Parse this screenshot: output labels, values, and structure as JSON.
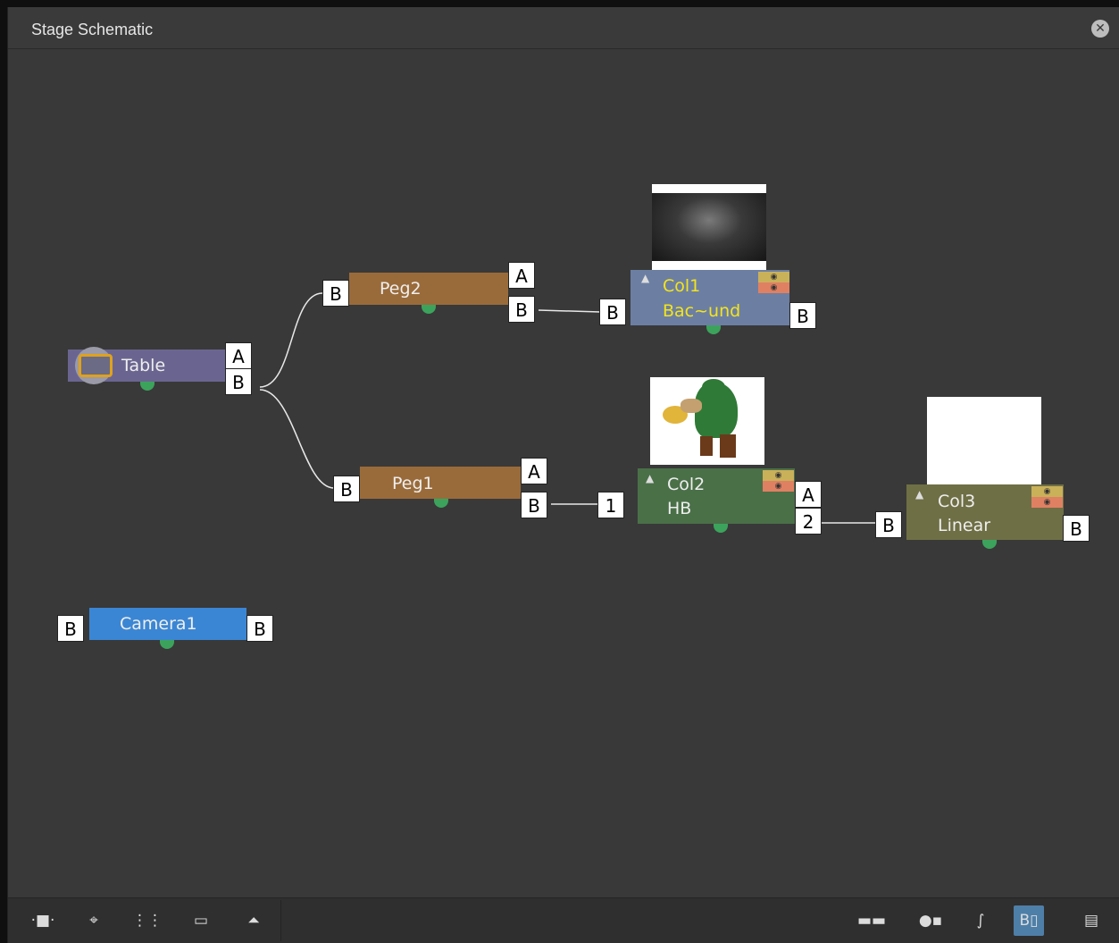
{
  "window": {
    "title": "Stage Schematic"
  },
  "nodes": {
    "table": {
      "label": "Table",
      "port_a": "A",
      "port_b": "B"
    },
    "peg2": {
      "label": "Peg2",
      "in_port": "B",
      "port_a": "A",
      "port_b": "B"
    },
    "peg1": {
      "label": "Peg1",
      "in_port": "B",
      "port_a": "A",
      "port_b": "B"
    },
    "col1": {
      "name": "Col1",
      "sub": "Bac~und",
      "in_port": "B",
      "out_port": "B"
    },
    "col2": {
      "name": "Col2",
      "sub": "HB",
      "in_port": "1",
      "port_a": "A",
      "port_2": "2"
    },
    "col3": {
      "name": "Col3",
      "sub": "Linear",
      "in_port": "B",
      "out_port": "B"
    },
    "camera1": {
      "label": "Camera1",
      "in_port": "B",
      "out_port": "B"
    }
  },
  "colors": {
    "table": "#6a6590",
    "peg": "#9a6b3a",
    "col1": "#6c7fa3",
    "col2": "#4a7048",
    "col3": "#6f6f46",
    "camera": "#3b86d4",
    "col1_text": "#f4e41a",
    "link_dot": "#3ca35c"
  },
  "icons": {
    "close": "close-circle-icon",
    "toolbar_left": [
      "fit-to-window-icon",
      "focus-on-current-icon",
      "reorder-nodes-icon",
      "normal-size-icon",
      "toggle-preview-icon"
    ],
    "toolbar_right": [
      "toggle-minimize-icon",
      "new-camera-peg-icon",
      "motion-path-icon",
      "stage-fx-toggle-icon",
      "output-icon"
    ]
  },
  "toolbar": {
    "buttons_left": [
      "·■·",
      "⌖",
      "⋮⋮",
      "▭",
      "⏶"
    ],
    "buttons_right": [
      "▬▬",
      "●▪",
      "∫",
      "B▯",
      "▤"
    ]
  }
}
